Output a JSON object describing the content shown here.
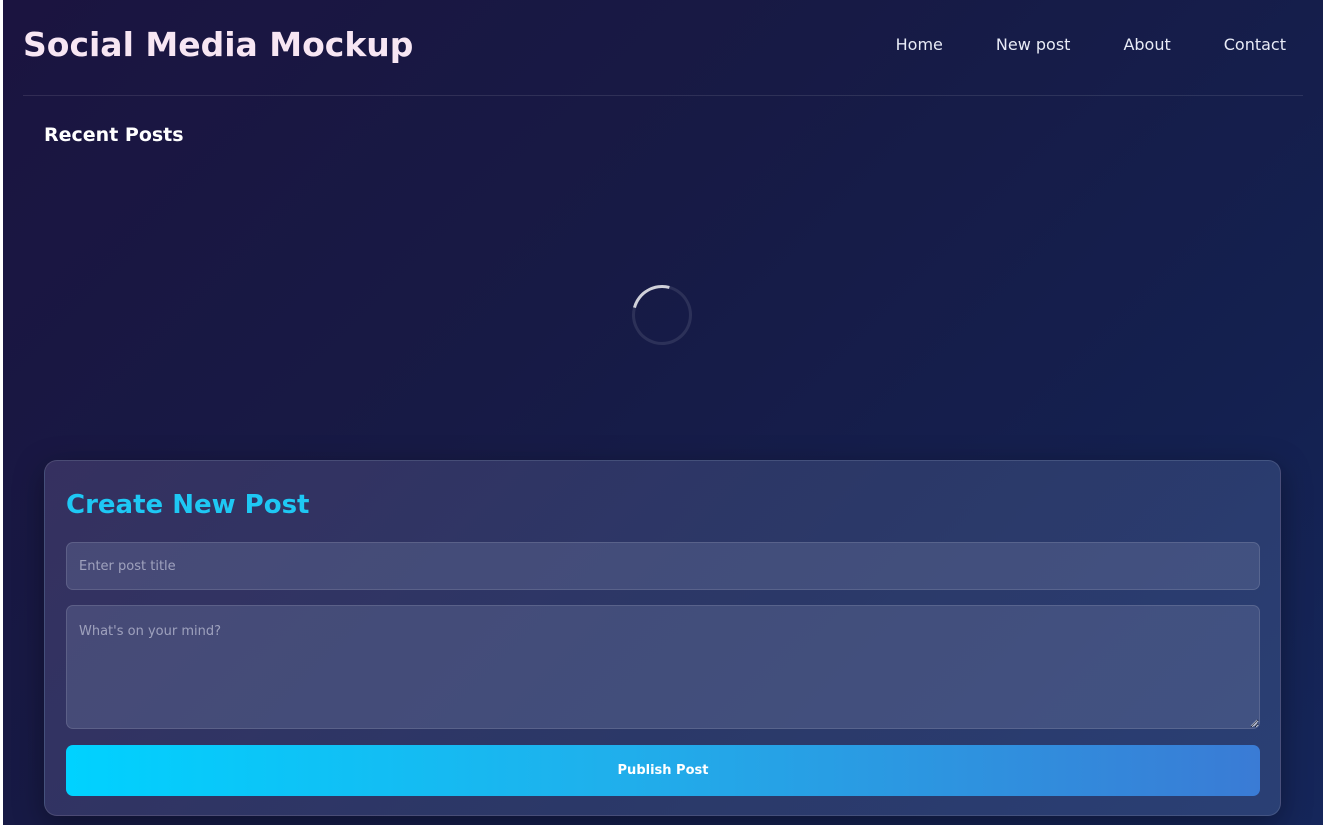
{
  "header": {
    "site_title": "Social Media Mockup",
    "nav": [
      {
        "label": "Home"
      },
      {
        "label": "New post"
      },
      {
        "label": "About"
      },
      {
        "label": "Contact"
      }
    ]
  },
  "feed": {
    "heading": "Recent Posts",
    "loading": true
  },
  "create_post": {
    "heading": "Create New Post",
    "title_placeholder": "Enter post title",
    "title_value": "",
    "body_placeholder": "What's on your mind?",
    "body_value": "",
    "publish_label": "Publish Post"
  },
  "colors": {
    "accent": "#1ec8f4",
    "button_gradient_start": "#00d2ff",
    "button_gradient_end": "#3a7bd5",
    "background": "#171a45"
  }
}
